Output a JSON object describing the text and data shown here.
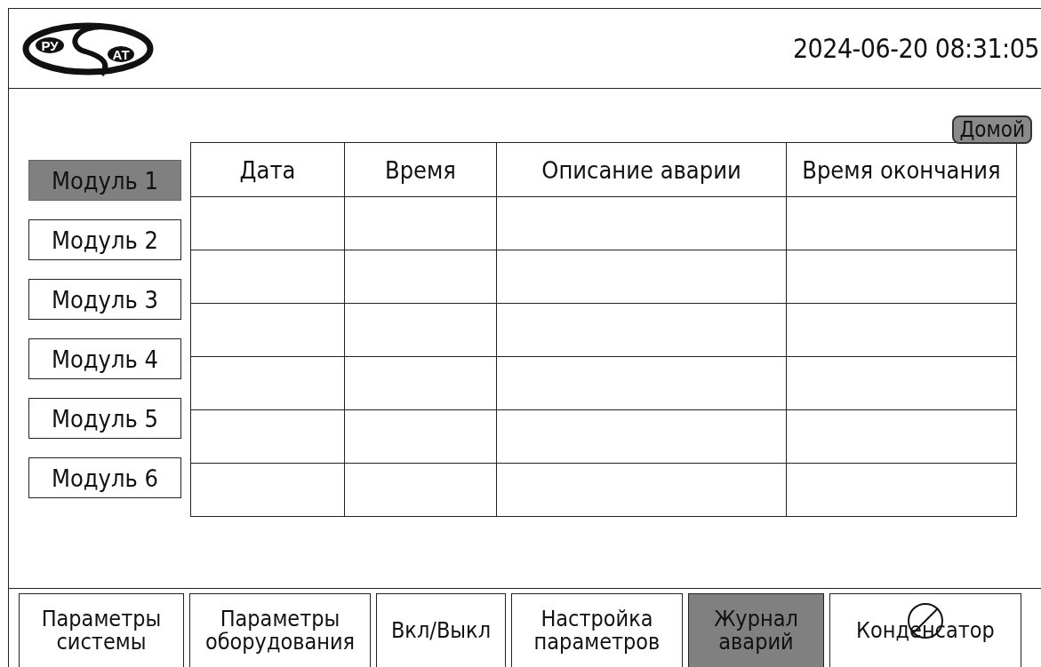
{
  "header": {
    "logo": {
      "left": "РУ",
      "right": "АТ"
    },
    "datetime": "2024-06-20 08:31:05"
  },
  "home_button": "Домой",
  "modules": [
    {
      "label": "Модуль 1",
      "selected": true
    },
    {
      "label": "Модуль 2",
      "selected": false
    },
    {
      "label": "Модуль 3",
      "selected": false
    },
    {
      "label": "Модуль 4",
      "selected": false
    },
    {
      "label": "Модуль 5",
      "selected": false
    },
    {
      "label": "Модуль 6",
      "selected": false
    }
  ],
  "table": {
    "columns": [
      "Дата",
      "Время",
      "Описание аварии",
      "Время окончания"
    ]
  },
  "nav": [
    {
      "label": "Параметры системы",
      "selected": false,
      "blocked": false
    },
    {
      "label": "Параметры оборудования",
      "selected": false,
      "blocked": false
    },
    {
      "label": "Вкл/Выкл",
      "selected": false,
      "blocked": false
    },
    {
      "label": "Настройка параметров",
      "selected": false,
      "blocked": false
    },
    {
      "label": "Журнал аварий",
      "selected": true,
      "blocked": false
    },
    {
      "label": "Конденсатор",
      "selected": false,
      "blocked": true
    }
  ]
}
